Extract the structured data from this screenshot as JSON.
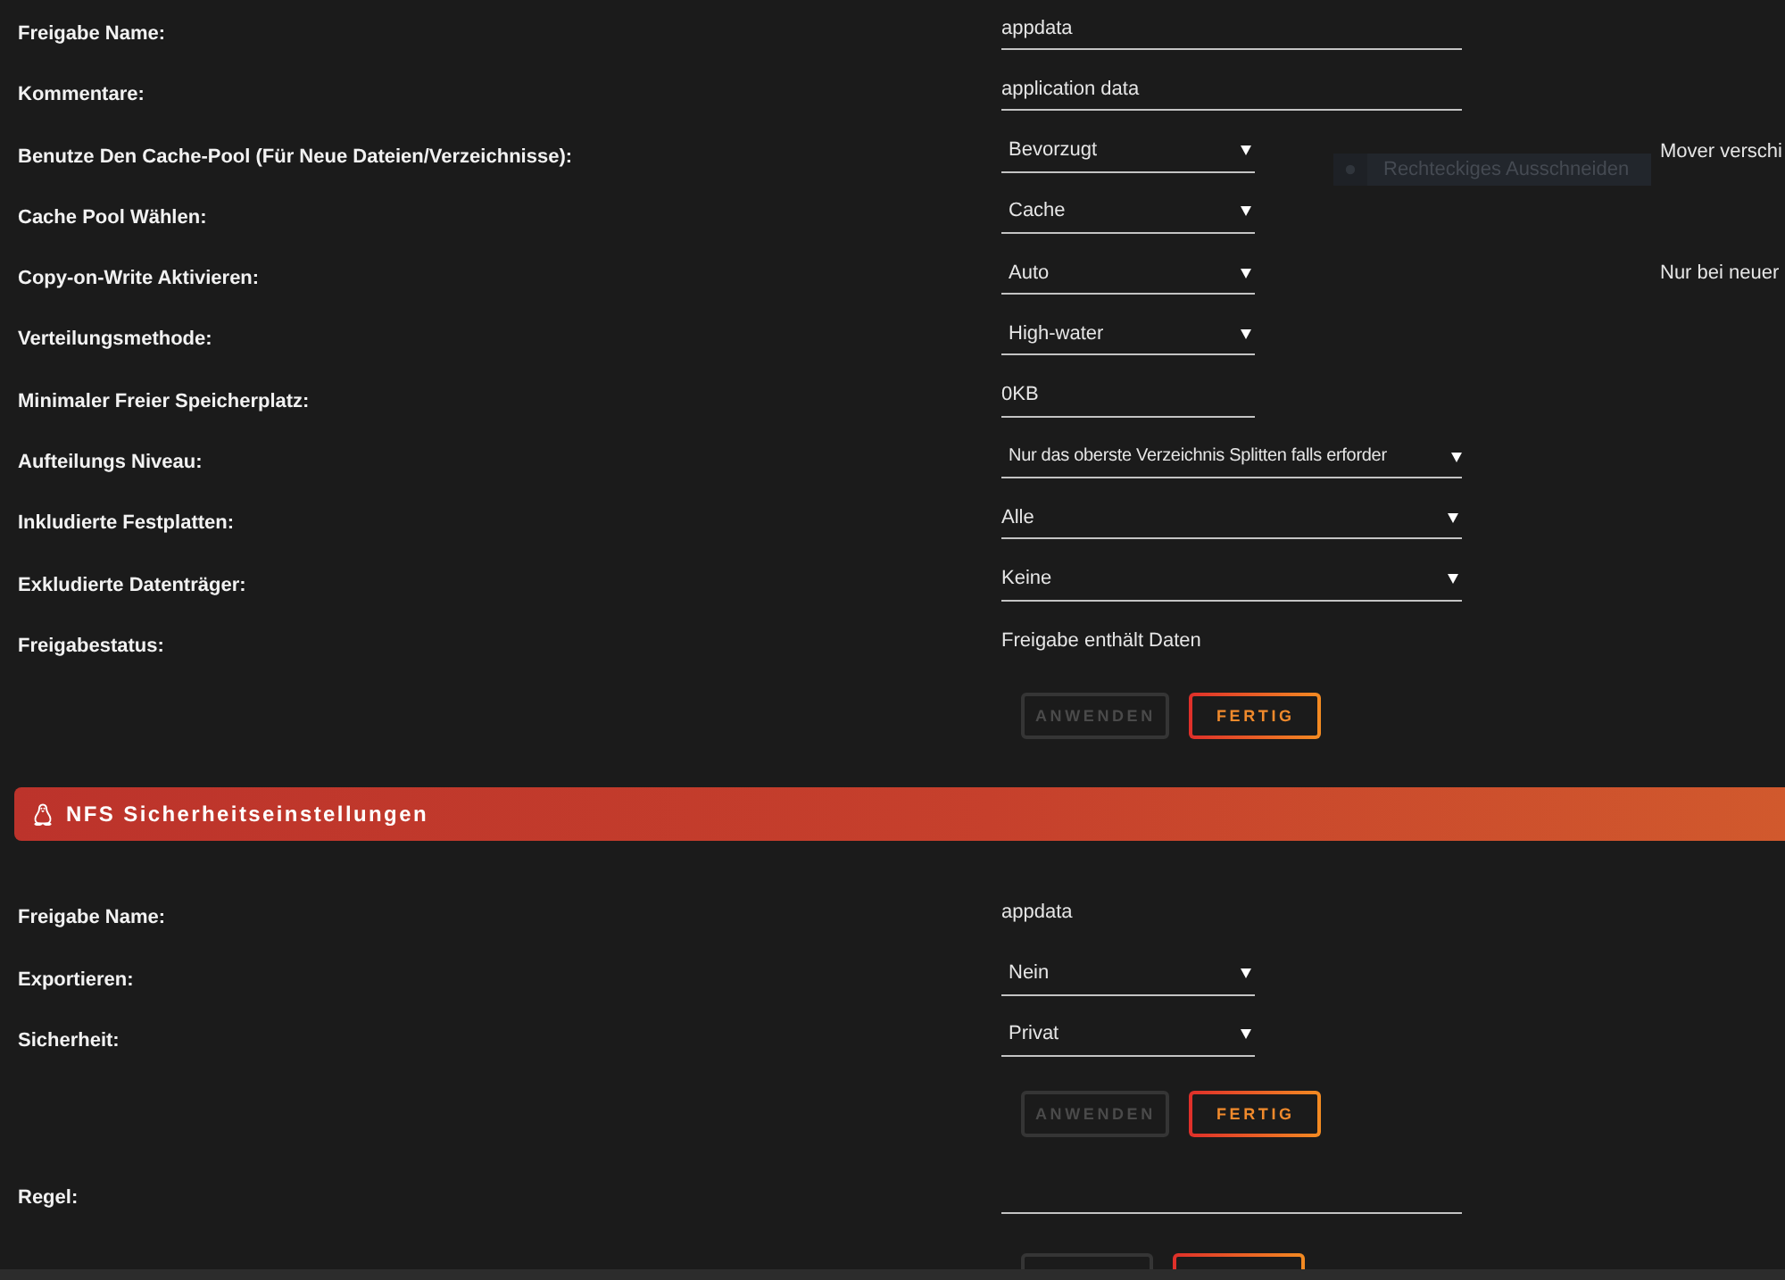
{
  "share_settings": {
    "rows": [
      {
        "kind": "input",
        "label": "Freigabe Name:",
        "value": "appdata"
      },
      {
        "kind": "input",
        "label": "Kommentare:",
        "value": "application data"
      },
      {
        "kind": "select",
        "label": "Benutze Den Cache-Pool (Für Neue Dateien/Verzeichnisse):",
        "value": "Bevorzugt",
        "note": "Mover verschi"
      },
      {
        "kind": "select",
        "label": "Cache Pool Wählen:",
        "value": "Cache"
      },
      {
        "kind": "select",
        "label": "Copy-on-Write Aktivieren:",
        "value": "Auto",
        "note": "Nur bei neuer"
      },
      {
        "kind": "select",
        "label": "Verteilungsmethode:",
        "value": "High-water"
      },
      {
        "kind": "quantity",
        "label": "Minimaler Freier Speicherplatz:",
        "value": "0KB"
      },
      {
        "kind": "wideselect",
        "label": "Aufteilungs Niveau:",
        "value": "Nur das oberste Verzeichnis Splitten falls erforder"
      },
      {
        "kind": "multiselect",
        "label": "Inkludierte Festplatten:",
        "value": "Alle"
      },
      {
        "kind": "multiselect",
        "label": "Exkludierte Datenträger:",
        "value": "Keine"
      },
      {
        "kind": "status",
        "label": "Freigabestatus:",
        "value": "Freigabe enthält Daten"
      }
    ],
    "buttons": [
      {
        "label": "ANWENDEN",
        "disabled": true
      },
      {
        "label": "FERTIG",
        "disabled": false
      }
    ]
  },
  "overlay_tooltip": {
    "text": "Rechteckiges Ausschneiden"
  },
  "nfs_section": {
    "title": "NFS Sicherheitseinstellungen",
    "rows": [
      {
        "kind": "status",
        "label": "Freigabe Name:",
        "value": "appdata"
      },
      {
        "kind": "select",
        "label": "Exportieren:",
        "value": "Nein"
      },
      {
        "kind": "select",
        "label": "Sicherheit:",
        "value": "Privat"
      }
    ],
    "buttons": [
      {
        "label": "ANWENDEN",
        "disabled": true
      },
      {
        "label": "FERTIG",
        "disabled": false
      }
    ],
    "rule_row": {
      "kind": "input",
      "label": "Regel:"
    },
    "rule_buttons": [
      {
        "disabled": true
      },
      {
        "disabled": false
      }
    ]
  }
}
